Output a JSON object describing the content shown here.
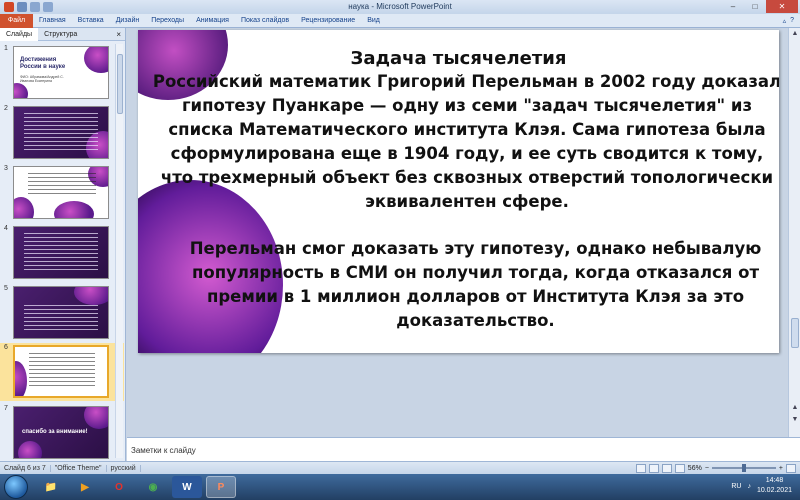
{
  "window": {
    "title": "наука - Microsoft PowerPoint",
    "controls": [
      "–",
      "□",
      "✕"
    ]
  },
  "ribbon": {
    "file": "Файл",
    "tabs": [
      "Главная",
      "Вставка",
      "Дизайн",
      "Переходы",
      "Анимация",
      "Показ слайдов",
      "Рецензирование",
      "Вид"
    ],
    "right_icons": [
      "▵",
      "?"
    ]
  },
  "panel": {
    "tabs": [
      "Слайды",
      "Структура"
    ],
    "close": "×",
    "thumbnails": [
      {
        "num": "1",
        "title": "Достижения России в науке",
        "subtitle": "ФИО: Абрамова/Андрей С.\nИванова Екатерина"
      },
      {
        "num": "2"
      },
      {
        "num": "3"
      },
      {
        "num": "4"
      },
      {
        "num": "5"
      },
      {
        "num": "6"
      },
      {
        "num": "7",
        "text": "спасибо за внимание!"
      }
    ],
    "selected_index": 6
  },
  "slide": {
    "title": "Задача тысячелетия",
    "paragraph1": "Российский математик Григорий Перельман в 2002 году доказал гипотезу Пуанкаре — одну из семи \"задач тысячелетия\" из списка Математического института Клэя. Сама гипотеза была сформулирована еще в 1904 году, и ее суть сводится к тому, что трехмерный объект без сквозных отверстий топологически эквивалентен сфере.",
    "paragraph2": "Перельман смог доказать эту гипотезу, однако небывалую популярность в СМИ он получил тогда, когда отказался от премии в 1 миллион долларов от Института Клэя за это доказательство."
  },
  "notes": {
    "placeholder": "Заметки к слайду"
  },
  "status": {
    "slide": "Слайд 6 из 7",
    "theme": "\"Office Theme\"",
    "language": "русский",
    "zoom": "56%",
    "zoom_minus": "−",
    "zoom_plus": "+"
  },
  "taskbar": {
    "apps": [
      "📁",
      "▶",
      "O",
      "◉",
      "W",
      "P"
    ],
    "language": "RU",
    "time": "14:48",
    "date": "10.02.2021"
  },
  "colors": {
    "accent_purple": "#5a1a8c",
    "blob_magenta": "#c94fc6",
    "file_tab": "#d0522e",
    "selected_thumb": "#fbe39c"
  }
}
